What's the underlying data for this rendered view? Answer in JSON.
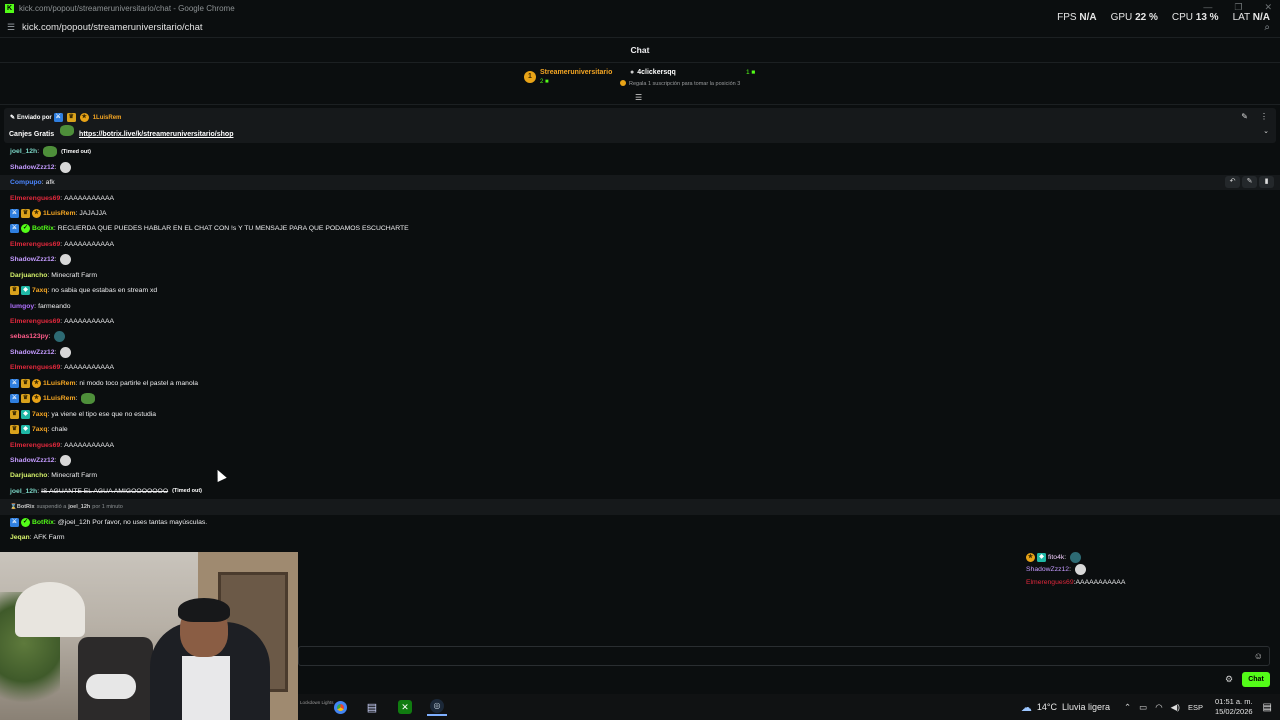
{
  "window": {
    "title": "kick.com/popout/streameruniversitario/chat - Google Chrome",
    "url": "kick.com/popout/streameruniversitario/chat"
  },
  "perf": {
    "fps_label": "FPS",
    "fps_value": "N/A",
    "gpu_label": "GPU",
    "gpu_value": "22 %",
    "cpu_label": "CPU",
    "cpu_value": "13 %",
    "lat_label": "LAT",
    "lat_value": "N/A"
  },
  "chat_header": {
    "title": "Chat"
  },
  "leaderboard": {
    "rank": "1",
    "top_user": "Streameruniversitario",
    "top_count": "2",
    "second_user": "4clickersqq",
    "second_count": "1",
    "hint": "Regala 1 suscripción para tomar la posición 3"
  },
  "pinned": {
    "sent_by_label": "Enviado por",
    "sent_by_user": "1LuisRem",
    "text": "Canjes Gratis",
    "link": "https://botrix.live/k/streameruniversitario/shop"
  },
  "colors": {
    "accent": "#53fc18",
    "mod": "#2f7fe0",
    "sub": "#e8a317"
  },
  "messages": [
    {
      "user": "joel_12h",
      "color": "#7ad4c4",
      "emote": "frog",
      "timed": "(Timed out)"
    },
    {
      "user": "ShadowZzz12",
      "color": "#c49bff",
      "emote": "ghost"
    },
    {
      "user": "Compupo",
      "color": "#4b86ff",
      "text": "afk",
      "highlight": true
    },
    {
      "user": "Elmerengues69",
      "color": "#e0283c",
      "text": "AAAAAAAAAAA"
    },
    {
      "user": "1LuisRem",
      "color": "#f5a623",
      "badges": [
        "mod",
        "crown",
        "sub"
      ],
      "text": "JAJAJJA"
    },
    {
      "user": "BotRix",
      "color": "#53fc18",
      "badges": [
        "mod",
        "verified"
      ],
      "text": "RECUERDA QUE PUEDES HABLAR EN EL CHAT CON !s Y TU MENSAJE PARA QUE PODAMOS ESCUCHARTE"
    },
    {
      "user": "Elmerengues69",
      "color": "#e0283c",
      "text": "AAAAAAAAAAA"
    },
    {
      "user": "ShadowZzz12",
      "color": "#c49bff",
      "emote": "ghost"
    },
    {
      "user": "Darjuancho",
      "color": "#d4f06a",
      "text": "Minecraft Farm"
    },
    {
      "user": "7axq",
      "color": "#f5a623",
      "badges": [
        "crown",
        "vip"
      ],
      "text": "no sabia que estabas en stream xd"
    },
    {
      "user": "lumgoy",
      "color": "#b070ff",
      "text": "farmeando"
    },
    {
      "user": "Elmerengues69",
      "color": "#e0283c",
      "text": "AAAAAAAAAAA"
    },
    {
      "user": "sebas123py",
      "color": "#ff5c8a",
      "emote": "pepe"
    },
    {
      "user": "ShadowZzz12",
      "color": "#c49bff",
      "emote": "ghost"
    },
    {
      "user": "Elmerengues69",
      "color": "#e0283c",
      "text": "AAAAAAAAAAA"
    },
    {
      "user": "1LuisRem",
      "color": "#f5a623",
      "badges": [
        "mod",
        "crown",
        "sub"
      ],
      "text": "ni modo toco partirle el pastel a manola"
    },
    {
      "user": "1LuisRem",
      "color": "#f5a623",
      "badges": [
        "mod",
        "crown",
        "sub"
      ],
      "emote": "frog"
    },
    {
      "user": "7axq",
      "color": "#f5a623",
      "badges": [
        "crown",
        "vip"
      ],
      "text": "ya viene el tipo ese que no estudia"
    },
    {
      "user": "7axq",
      "color": "#f5a623",
      "badges": [
        "crown",
        "vip"
      ],
      "text": "chale"
    },
    {
      "user": "Elmerengues69",
      "color": "#e0283c",
      "text": "AAAAAAAAAAA"
    },
    {
      "user": "ShadowZzz12",
      "color": "#c49bff",
      "emote": "ghost"
    },
    {
      "user": "Darjuancho",
      "color": "#d4f06a",
      "text": "Minecraft Farm"
    },
    {
      "user": "joel_12h",
      "color": "#7ad4c4",
      "strike": "IS AGUANTE EL AGUA AMIGOOOOOOO",
      "timed": "(Timed out)"
    },
    {
      "system": true,
      "actor": "BotRix",
      "action": "suspendió a",
      "target": "joel_12h",
      "duration": "por 1 minuto",
      "highlight": true
    },
    {
      "user": "BotRix",
      "color": "#53fc18",
      "badges": [
        "mod",
        "verified"
      ],
      "text": "@joel_12h Por favor, no uses tantas mayúsculas."
    },
    {
      "user": "Jeqan",
      "color": "#d4f06a",
      "text": "AFK Farm"
    }
  ],
  "mini_chat": [
    {
      "user": "fito4k",
      "color": "#f5d0ff",
      "badges": [
        "sub",
        "vip"
      ],
      "emote": "pepe"
    },
    {
      "user": "ShadowZzz12",
      "color": "#c49bff",
      "emote": "ghost"
    },
    {
      "user": "Elmerengues69",
      "color": "#e0283c",
      "text": "AAAAAAAAAAA"
    }
  ],
  "chat_input": {
    "placeholder": "",
    "send_label": "Chat"
  },
  "taskbar": {
    "lock_text": "Lockdown Lights",
    "weather_temp": "14°C",
    "weather_desc": "Lluvia ligera",
    "lang": "ESP",
    "time": "01:51 a. m.",
    "date": "15/02/2026"
  }
}
